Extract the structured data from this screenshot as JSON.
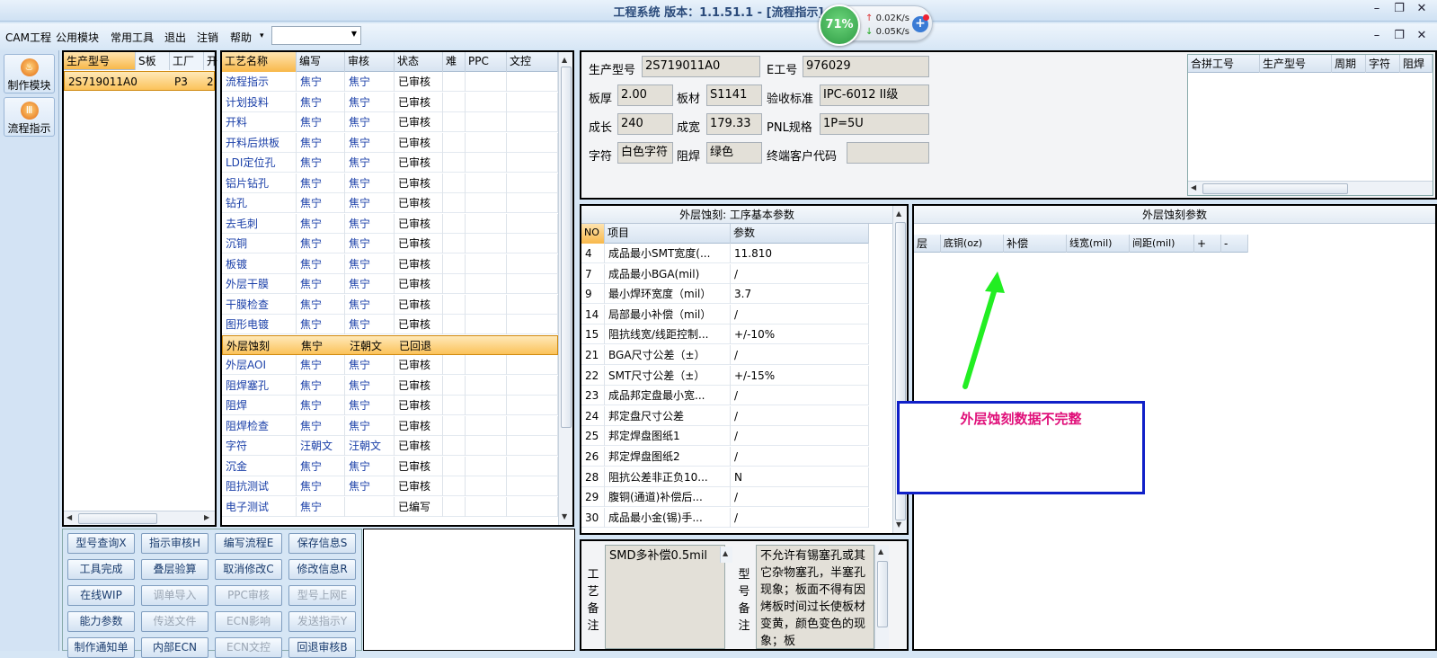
{
  "window": {
    "title": "工程系统   版本：1.1.51.1 - [流程指示]"
  },
  "menu": {
    "items": [
      "CAM工程",
      "公用模块",
      "常用工具",
      "退出",
      "注销",
      "帮助"
    ],
    "overflow_arrow": "▾",
    "combo_value": ""
  },
  "net_widget": {
    "cpu": "71%",
    "up": "0.02K/s",
    "down": "0.05K/s",
    "up_arrow": "↑",
    "down_arrow": "↓",
    "plus": "+"
  },
  "left_toolbar": {
    "items": [
      {
        "label": "制作模块",
        "icon": "fire-icon"
      },
      {
        "label": "流程指示",
        "icon": "flow-icon"
      }
    ]
  },
  "order_list": {
    "columns": [
      "生产型号",
      "S板",
      "工厂",
      "开"
    ],
    "rows": [
      [
        "2S719011A0",
        "",
        "P3",
        "2"
      ]
    ]
  },
  "process_table": {
    "columns": [
      "工艺名称",
      "编写",
      "审核",
      "状态",
      "难",
      "PPC",
      "文控"
    ],
    "rows": [
      [
        "流程指示",
        "焦宁",
        "焦宁",
        "已审核"
      ],
      [
        "计划投料",
        "焦宁",
        "焦宁",
        "已审核"
      ],
      [
        "开料",
        "焦宁",
        "焦宁",
        "已审核"
      ],
      [
        "开料后烘板",
        "焦宁",
        "焦宁",
        "已审核"
      ],
      [
        "LDI定位孔",
        "焦宁",
        "焦宁",
        "已审核"
      ],
      [
        "铝片钻孔",
        "焦宁",
        "焦宁",
        "已审核"
      ],
      [
        "钻孔",
        "焦宁",
        "焦宁",
        "已审核"
      ],
      [
        "去毛刺",
        "焦宁",
        "焦宁",
        "已审核"
      ],
      [
        "沉铜",
        "焦宁",
        "焦宁",
        "已审核"
      ],
      [
        "板镀",
        "焦宁",
        "焦宁",
        "已审核"
      ],
      [
        "外层干膜",
        "焦宁",
        "焦宁",
        "已审核"
      ],
      [
        "干膜检查",
        "焦宁",
        "焦宁",
        "已审核"
      ],
      [
        "图形电镀",
        "焦宁",
        "焦宁",
        "已审核"
      ],
      [
        "外层蚀刻",
        "焦宁",
        "汪朝文",
        "已回退"
      ],
      [
        "外层AOI",
        "焦宁",
        "焦宁",
        "已审核"
      ],
      [
        "阻焊塞孔",
        "焦宁",
        "焦宁",
        "已审核"
      ],
      [
        "阻焊",
        "焦宁",
        "焦宁",
        "已审核"
      ],
      [
        "阻焊检查",
        "焦宁",
        "焦宁",
        "已审核"
      ],
      [
        "字符",
        "汪朝文",
        "汪朝文",
        "已审核"
      ],
      [
        "沉金",
        "焦宁",
        "焦宁",
        "已审核"
      ],
      [
        "阻抗测试",
        "焦宁",
        "焦宁",
        "已审核"
      ],
      [
        "电子测试",
        "焦宁",
        "",
        "已编写"
      ]
    ],
    "selected_index": 13
  },
  "action_buttons": [
    {
      "label": "型号查询X",
      "enabled": true
    },
    {
      "label": "指示审核H",
      "enabled": true
    },
    {
      "label": "编写流程E",
      "enabled": true
    },
    {
      "label": "保存信息S",
      "enabled": true
    },
    {
      "label": "工具完成",
      "enabled": true
    },
    {
      "label": "叠层验算",
      "enabled": true
    },
    {
      "label": "取消修改C",
      "enabled": true
    },
    {
      "label": "修改信息R",
      "enabled": true
    },
    {
      "label": "在线WIP",
      "enabled": true
    },
    {
      "label": "调单导入",
      "enabled": false
    },
    {
      "label": "PPC审核",
      "enabled": false
    },
    {
      "label": "型号上网E",
      "enabled": false
    },
    {
      "label": "能力参数",
      "enabled": true
    },
    {
      "label": "传送文件",
      "enabled": false
    },
    {
      "label": "ECN影响",
      "enabled": false
    },
    {
      "label": "发送指示Y",
      "enabled": false
    },
    {
      "label": "制作通知单",
      "enabled": true
    },
    {
      "label": "内部ECN",
      "enabled": true
    },
    {
      "label": "ECN文控",
      "enabled": false
    },
    {
      "label": "回退审核B",
      "enabled": true
    }
  ],
  "info": {
    "model_label": "生产型号",
    "model_value": "2S719011A0",
    "eno_label": "E工号",
    "eno_value": "976029",
    "thickness_label": "板厚",
    "thickness_value": "2.00",
    "material_label": "板材",
    "material_value": "S1141",
    "standard_label": "验收标准",
    "standard_value": "IPC-6012 II级",
    "length_label": "成长",
    "length_value": "240",
    "width_label": "成宽",
    "width_value": "179.33",
    "pnl_label": "PNL规格",
    "pnl_value": "1P=5U",
    "char_label": "字符",
    "char_value": "白色字符",
    "mask_label": "阻焊",
    "mask_value": "绿色",
    "customer_label": "终端客户代码",
    "customer_value": ""
  },
  "combo_table": {
    "columns": [
      "合拼工号",
      "生产型号",
      "周期",
      "字符",
      "阻焊"
    ]
  },
  "base_params": {
    "title": "外层蚀刻: 工序基本参数",
    "columns": [
      "NO",
      "项目",
      "参数"
    ],
    "rows": [
      [
        "4",
        "成品最小SMT宽度(...",
        "11.810"
      ],
      [
        "7",
        "成品最小BGA(mil)",
        "/"
      ],
      [
        "9",
        "最小焊环宽度（mil）",
        "3.7"
      ],
      [
        "14",
        "局部最小补偿（mil）",
        "/"
      ],
      [
        "15",
        "阻抗线宽/线距控制...",
        "+/-10%"
      ],
      [
        "21",
        "BGA尺寸公差（±）",
        "/"
      ],
      [
        "22",
        "SMT尺寸公差（±）",
        "+/-15%"
      ],
      [
        "23",
        "成品邦定盘最小宽...",
        "/"
      ],
      [
        "24",
        "邦定盘尺寸公差",
        "/"
      ],
      [
        "25",
        "邦定焊盘图纸1",
        "/"
      ],
      [
        "26",
        "邦定焊盘图纸2",
        "/"
      ],
      [
        "28",
        "阻抗公差非正负10...",
        "N"
      ],
      [
        "29",
        "腹铜(通道)补偿后...",
        "/"
      ],
      [
        "30",
        "成品最小金(锡)手...",
        "/"
      ]
    ]
  },
  "etch_params": {
    "title": "外层蚀刻参数",
    "columns": [
      "层",
      "底铜(oz)",
      "补偿",
      "线宽(mil)",
      "间距(mil)",
      "+",
      "-"
    ]
  },
  "annotation": {
    "text": "外层蚀刻数据不完整",
    "text_color": "#e0107a",
    "arrow_color": "#22ee22",
    "box_color": "#1020c8"
  },
  "remarks": {
    "process_label": "工艺备注",
    "process_text": "SMD多补偿0.5mil",
    "model_label": "型号备注",
    "model_text": "不允许有锡塞孔或其它杂物塞孔，半塞孔现象；板面不得有因烤板时间过长使板材变黄，颜色变色的现象；板"
  }
}
